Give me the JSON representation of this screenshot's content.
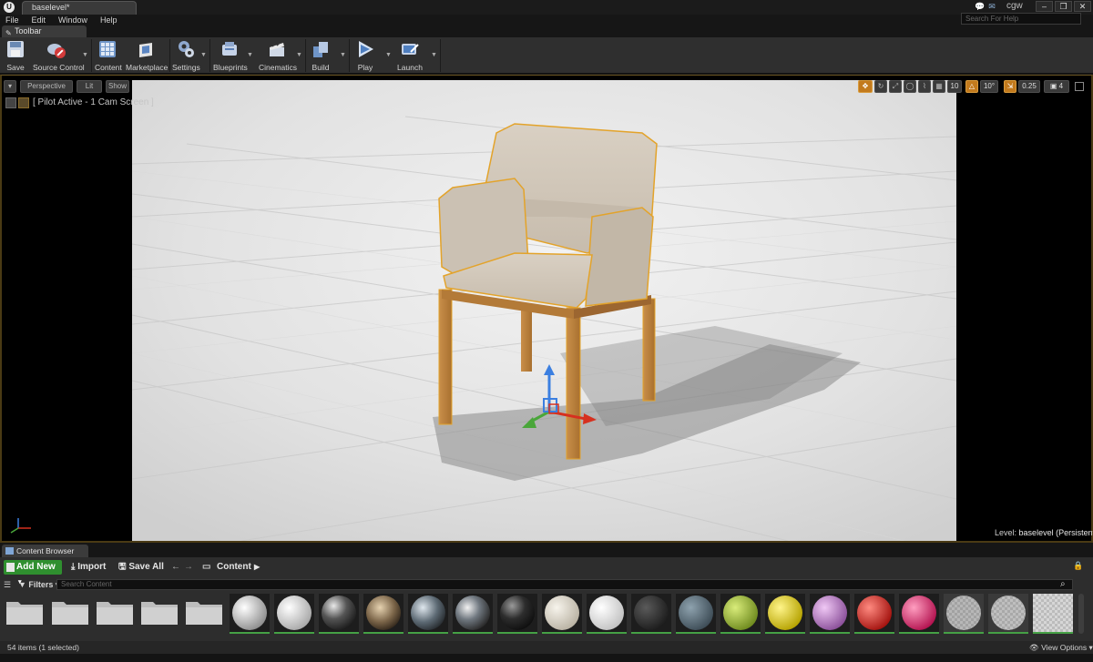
{
  "titlebar": {
    "level_tab": "baselevel*",
    "user": "cgw",
    "min": "–",
    "max": "❐",
    "close": "✕"
  },
  "menu": [
    "File",
    "Edit",
    "Window",
    "Help"
  ],
  "help_search": {
    "placeholder": "Search For Help"
  },
  "toolbar": {
    "tab_label": "Toolbar",
    "buttons": [
      {
        "label": "Save",
        "icon": "save-icon"
      },
      {
        "label": "Source Control",
        "icon": "source-control-icon"
      },
      {
        "label": "Content",
        "icon": "content-icon"
      },
      {
        "label": "Marketplace",
        "icon": "marketplace-icon"
      },
      {
        "label": "Settings",
        "icon": "settings-icon"
      },
      {
        "label": "Blueprints",
        "icon": "blueprints-icon"
      },
      {
        "label": "Cinematics",
        "icon": "cinematics-icon"
      },
      {
        "label": "Build",
        "icon": "build-icon"
      },
      {
        "label": "Play",
        "icon": "play-icon"
      },
      {
        "label": "Launch",
        "icon": "launch-icon"
      }
    ]
  },
  "viewport": {
    "view_mode": "Perspective",
    "lit_mode": "Lit",
    "show": "Show",
    "pilot_label": "[ Pilot Active - 1 Cam Screen ]",
    "grid_snap": "10",
    "rotation_snap": "10°",
    "scale_snap": "0.25",
    "camera_speed": "4",
    "level_prefix": "Level:",
    "level_name": "baselevel (Persistent)"
  },
  "content_browser": {
    "tab_label": "Content Browser",
    "add_new": "Add New",
    "import": "Import",
    "save_all": "Save All",
    "path": "Content",
    "filters": "Filters",
    "search_placeholder": "Search Content",
    "item_count": "54 items (1 selected)",
    "view_options": "View Options"
  },
  "colors": {
    "accent_green": "#45a045",
    "selection_orange": "#e3a32a",
    "panel_bg": "#2d2d2d"
  }
}
